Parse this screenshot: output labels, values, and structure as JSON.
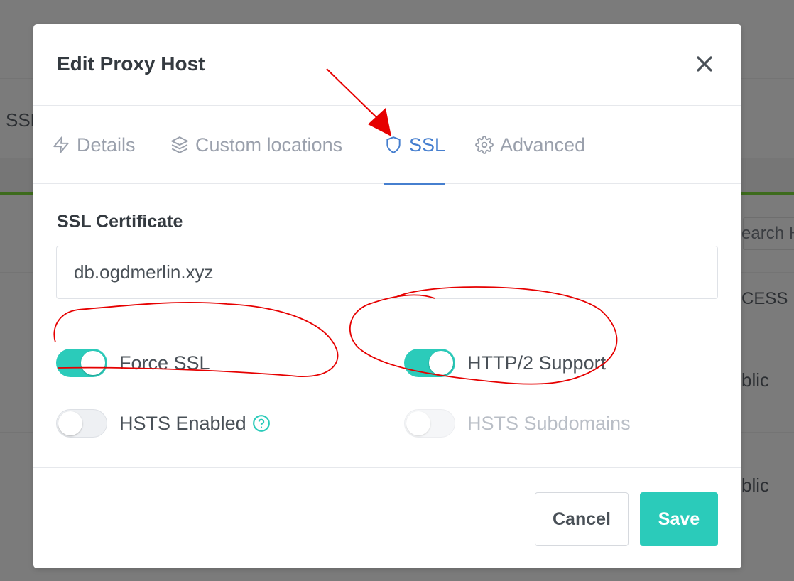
{
  "background": {
    "partial_texts": [
      "SSL",
      "earch H",
      "CESS",
      "blic",
      "blic"
    ]
  },
  "modal": {
    "title": "Edit Proxy Host",
    "tabs": [
      {
        "label": "Details",
        "icon": "lightning-icon",
        "active": false
      },
      {
        "label": "Custom locations",
        "icon": "layers-icon",
        "active": false
      },
      {
        "label": "SSL",
        "icon": "shield-icon",
        "active": true
      },
      {
        "label": "Advanced",
        "icon": "gear-icon",
        "active": false
      }
    ],
    "ssl": {
      "certificate_label": "SSL Certificate",
      "certificate_value": "db.ogdmerlin.xyz",
      "toggles": [
        {
          "label": "Force SSL",
          "on": true,
          "disabled": false
        },
        {
          "label": "HTTP/2 Support",
          "on": true,
          "disabled": false
        },
        {
          "label": "HSTS Enabled",
          "on": false,
          "disabled": false,
          "help_icon": "question-circle-icon"
        },
        {
          "label": "HSTS Subdomains",
          "on": false,
          "disabled": true
        }
      ]
    },
    "footer": {
      "cancel_label": "Cancel",
      "save_label": "Save"
    }
  },
  "colors": {
    "accent_teal": "#2bcbba",
    "active_tab_blue": "#467fcf",
    "annotation_red": "#e60000"
  }
}
